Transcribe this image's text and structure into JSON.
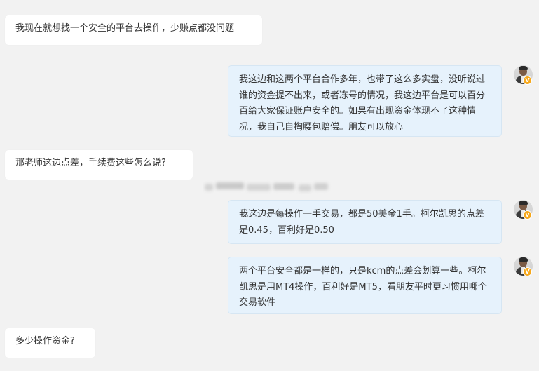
{
  "chat": {
    "messages": [
      {
        "side": "in",
        "text": "我现在就想找一个安全的平台去操作，少赚点都没问题"
      },
      {
        "side": "out",
        "text": "我这边和这两个平台合作多年，也带了这么多实盘，没听说过谁的资金提不出来，或者冻号的情况，我这边平台是可以百分百给大家保证账户安全的。如果有出现资金体现不了这种情况，我自己自掏腰包赔偿。朋友可以放心"
      },
      {
        "side": "in",
        "text": "那老师这边点差，手续费这些怎么说?"
      },
      {
        "side": "out",
        "text": "我这边是每操作一手交易，都是50美金1手。柯尔凯思的点差是0.45，百利好是0.50"
      },
      {
        "side": "out",
        "text": "两个平台安全都是一样的，只是kcm的点差会划算一些。柯尔凯思是用MT4操作，百利好是MT5，看朋友平时更习惯用哪个交易软件"
      },
      {
        "side": "in",
        "text": "多少操作资金?"
      }
    ],
    "avatar_badge": "V"
  },
  "colors": {
    "background": "#f2f2f2",
    "incoming_bubble": "#ffffff",
    "outgoing_bubble": "#e6f2fc",
    "verified_badge": "#f6a81c"
  }
}
